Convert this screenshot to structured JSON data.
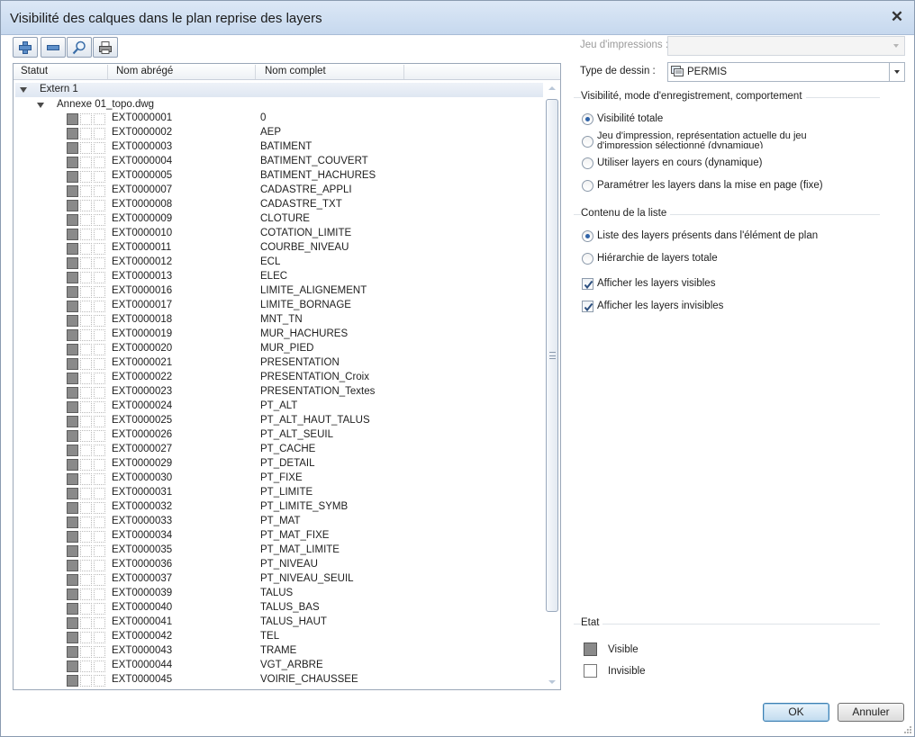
{
  "window": {
    "title": "Visibilité des calques dans le plan reprise des layers"
  },
  "tree": {
    "columns": [
      "Statut",
      "Nom abrégé",
      "Nom complet"
    ],
    "group": "Extern 1",
    "file": "Annexe 01_topo.dwg",
    "layers": [
      {
        "abbr": "EXT0000001",
        "full": "0"
      },
      {
        "abbr": "EXT0000002",
        "full": "AEP"
      },
      {
        "abbr": "EXT0000003",
        "full": "BATIMENT"
      },
      {
        "abbr": "EXT0000004",
        "full": "BATIMENT_COUVERT"
      },
      {
        "abbr": "EXT0000005",
        "full": "BATIMENT_HACHURES"
      },
      {
        "abbr": "EXT0000007",
        "full": "CADASTRE_APPLI"
      },
      {
        "abbr": "EXT0000008",
        "full": "CADASTRE_TXT"
      },
      {
        "abbr": "EXT0000009",
        "full": "CLOTURE"
      },
      {
        "abbr": "EXT0000010",
        "full": "COTATION_LIMITE"
      },
      {
        "abbr": "EXT0000011",
        "full": "COURBE_NIVEAU"
      },
      {
        "abbr": "EXT0000012",
        "full": "ECL"
      },
      {
        "abbr": "EXT0000013",
        "full": "ELEC"
      },
      {
        "abbr": "EXT0000016",
        "full": "LIMITE_ALIGNEMENT"
      },
      {
        "abbr": "EXT0000017",
        "full": "LIMITE_BORNAGE"
      },
      {
        "abbr": "EXT0000018",
        "full": "MNT_TN"
      },
      {
        "abbr": "EXT0000019",
        "full": "MUR_HACHURES"
      },
      {
        "abbr": "EXT0000020",
        "full": "MUR_PIED"
      },
      {
        "abbr": "EXT0000021",
        "full": "PRESENTATION"
      },
      {
        "abbr": "EXT0000022",
        "full": "PRESENTATION_Croix"
      },
      {
        "abbr": "EXT0000023",
        "full": "PRESENTATION_Textes"
      },
      {
        "abbr": "EXT0000024",
        "full": "PT_ALT"
      },
      {
        "abbr": "EXT0000025",
        "full": "PT_ALT_HAUT_TALUS"
      },
      {
        "abbr": "EXT0000026",
        "full": "PT_ALT_SEUIL"
      },
      {
        "abbr": "EXT0000027",
        "full": "PT_CACHE"
      },
      {
        "abbr": "EXT0000029",
        "full": "PT_DETAIL"
      },
      {
        "abbr": "EXT0000030",
        "full": "PT_FIXE"
      },
      {
        "abbr": "EXT0000031",
        "full": "PT_LIMITE"
      },
      {
        "abbr": "EXT0000032",
        "full": "PT_LIMITE_SYMB"
      },
      {
        "abbr": "EXT0000033",
        "full": "PT_MAT"
      },
      {
        "abbr": "EXT0000034",
        "full": "PT_MAT_FIXE"
      },
      {
        "abbr": "EXT0000035",
        "full": "PT_MAT_LIMITE"
      },
      {
        "abbr": "EXT0000036",
        "full": "PT_NIVEAU"
      },
      {
        "abbr": "EXT0000037",
        "full": "PT_NIVEAU_SEUIL"
      },
      {
        "abbr": "EXT0000039",
        "full": "TALUS"
      },
      {
        "abbr": "EXT0000040",
        "full": "TALUS_BAS"
      },
      {
        "abbr": "EXT0000041",
        "full": "TALUS_HAUT"
      },
      {
        "abbr": "EXT0000042",
        "full": "TEL"
      },
      {
        "abbr": "EXT0000043",
        "full": "TRAME"
      },
      {
        "abbr": "EXT0000044",
        "full": "VGT_ARBRE"
      },
      {
        "abbr": "EXT0000045",
        "full": "VOIRIE_CHAUSSEE"
      }
    ]
  },
  "right": {
    "print_set_label": "Jeu d'impressions :",
    "print_set_value": "",
    "drawing_type_label": "Type de dessin :",
    "drawing_type_value": "PERMIS",
    "visibility_group": "Visibilité, mode d'enregistrement, comportement",
    "visibility_options": [
      {
        "label": "Visibilité totale",
        "checked": true
      },
      {
        "label": "Jeu d'impression, représentation actuelle du jeu d'impression sélectionné (dynamique)",
        "checked": false
      },
      {
        "label": "Utiliser layers en cours (dynamique)",
        "checked": false
      },
      {
        "label": "Paramétrer les layers dans la mise en page (fixe)",
        "checked": false
      }
    ],
    "content_group": "Contenu de la liste",
    "content_options": [
      {
        "label": "Liste des layers présents dans l'élément de plan",
        "checked": true
      },
      {
        "label": "Hiérarchie de layers totale",
        "checked": false
      }
    ],
    "show_visible_label": "Afficher les layers visibles",
    "show_invisible_label": "Afficher les layers invisibles",
    "state_group": "Etat",
    "state_visible": "Visible",
    "state_invisible": "Invisible"
  },
  "buttons": {
    "ok": "OK",
    "cancel": "Annuler"
  },
  "colors": {
    "visible_swatch": "#8a8a8a",
    "accent": "#2f63a8"
  }
}
